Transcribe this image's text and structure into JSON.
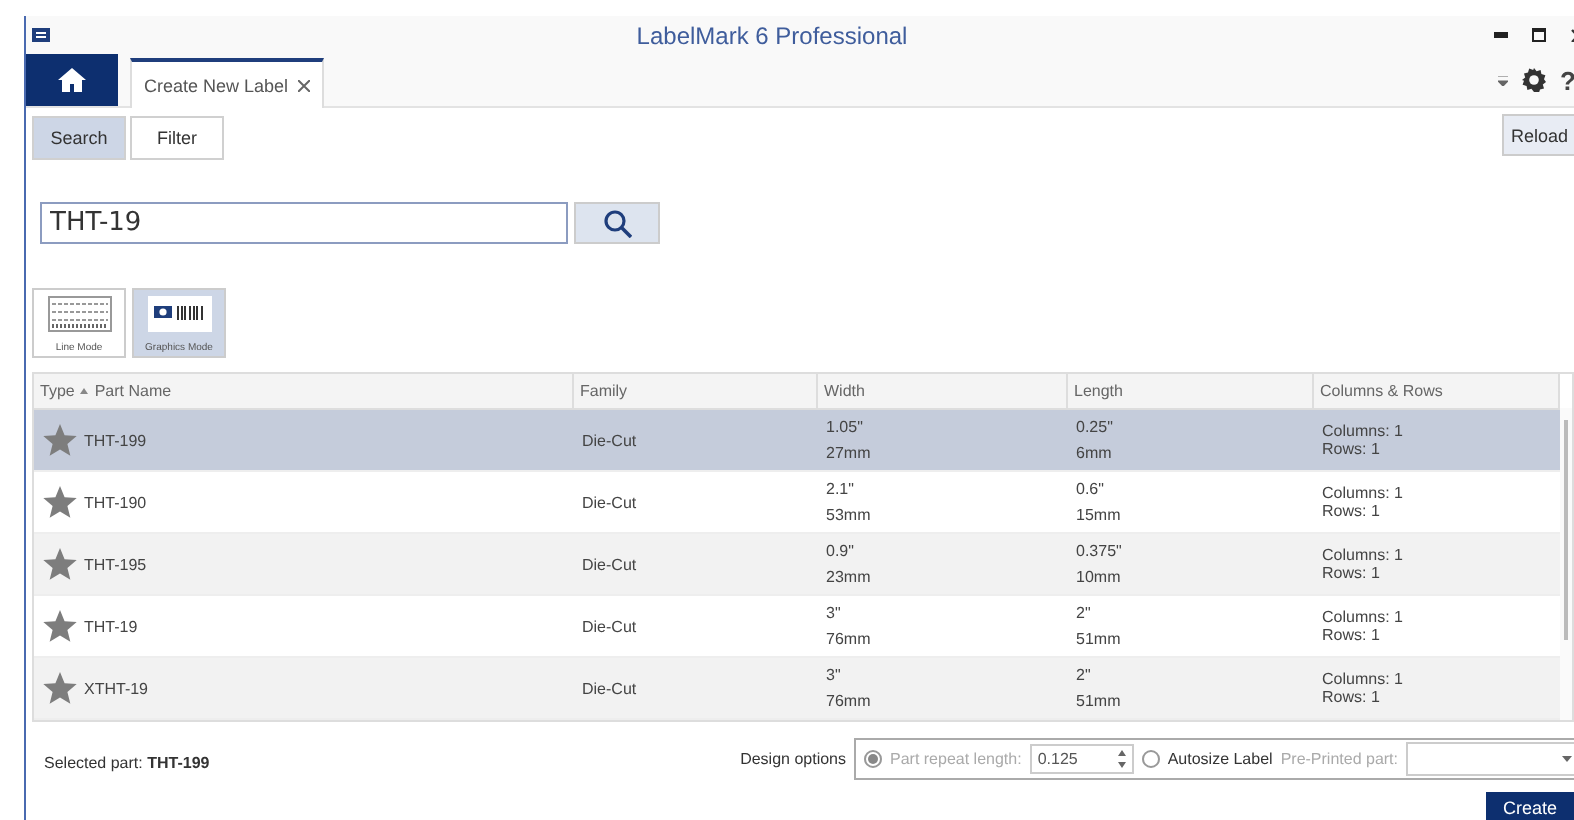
{
  "window": {
    "title": "LabelMark 6 Professional"
  },
  "tabs": [
    {
      "label": "Create New Label",
      "selected": true
    }
  ],
  "help_label": "?",
  "view_buttons": [
    {
      "label": "Search",
      "selected": true
    },
    {
      "label": "Filter",
      "selected": false
    }
  ],
  "reload_button": "Reload",
  "search": {
    "value": "THT-19"
  },
  "modes": [
    {
      "label": "Line Mode",
      "kind": "line",
      "selected": false
    },
    {
      "label": "Graphics Mode",
      "kind": "graphics",
      "selected": true
    }
  ],
  "table": {
    "columns": [
      "Type",
      "Part Name",
      "Family",
      "Width",
      "Length",
      "Columns & Rows"
    ],
    "rows": [
      {
        "part_name": "THT-199",
        "family": "Die-Cut",
        "width_in": "1.05\"",
        "width_mm": "27mm",
        "length_in": "0.25\"",
        "length_mm": "6mm",
        "columns": "Columns: 1",
        "rows": "Rows: 1",
        "selected": true
      },
      {
        "part_name": "THT-190",
        "family": "Die-Cut",
        "width_in": "2.1\"",
        "width_mm": "53mm",
        "length_in": "0.6\"",
        "length_mm": "15mm",
        "columns": "Columns: 1",
        "rows": "Rows: 1",
        "selected": false
      },
      {
        "part_name": "THT-195",
        "family": "Die-Cut",
        "width_in": "0.9\"",
        "width_mm": "23mm",
        "length_in": "0.375\"",
        "length_mm": "10mm",
        "columns": "Columns: 1",
        "rows": "Rows: 1",
        "selected": false
      },
      {
        "part_name": "THT-19",
        "family": "Die-Cut",
        "width_in": "3\"",
        "width_mm": "76mm",
        "length_in": "2\"",
        "length_mm": "51mm",
        "columns": "Columns: 1",
        "rows": "Rows: 1",
        "selected": false
      },
      {
        "part_name": "XTHT-19",
        "family": "Die-Cut",
        "width_in": "3\"",
        "width_mm": "76mm",
        "length_in": "2\"",
        "length_mm": "51mm",
        "columns": "Columns: 1",
        "rows": "Rows: 1",
        "selected": false
      }
    ]
  },
  "footer": {
    "selected_part": "Selected part: **THT-199**",
    "design_options_label": "Design options",
    "options": [
      {
        "label": "Part repeat length:",
        "selected": true,
        "disabled": true,
        "value": "0.125"
      },
      {
        "label": "Autosize Label",
        "selected": false,
        "disabled": false
      }
    ],
    "preprinted": {
      "label": "Pre-Printed part:",
      "disabled": true
    },
    "create_button": "Create"
  }
}
